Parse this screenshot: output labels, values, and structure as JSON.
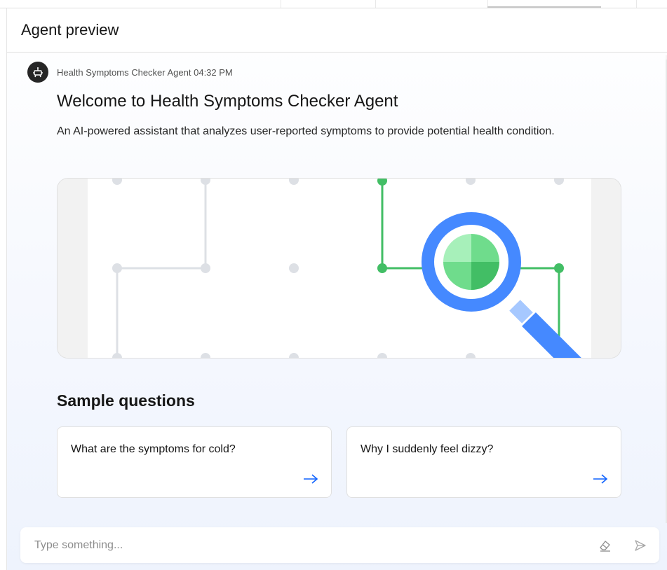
{
  "panel": {
    "title": "Agent preview"
  },
  "message": {
    "agent_name": "Health Symptoms Checker Agent",
    "time": "04:32 PM",
    "welcome_title": "Welcome to Health Symptoms Checker Agent",
    "description": "An AI-powered assistant that analyzes user-reported symptoms to provide potential health condition."
  },
  "sample_questions": {
    "title": "Sample questions",
    "items": [
      {
        "label": "What are the symptoms for cold?"
      },
      {
        "label": "Why I suddenly feel dizzy?"
      }
    ]
  },
  "composer": {
    "placeholder": "Type something..."
  },
  "colors": {
    "accent_blue": "#4589ff",
    "green": "#42be65",
    "light_green": "#6fdc8c",
    "grid_gray": "#d8dbe0"
  },
  "icons": {
    "avatar": "robot-icon",
    "question_arrow": "arrow-right-icon",
    "clear": "eraser-icon",
    "send": "send-icon"
  }
}
